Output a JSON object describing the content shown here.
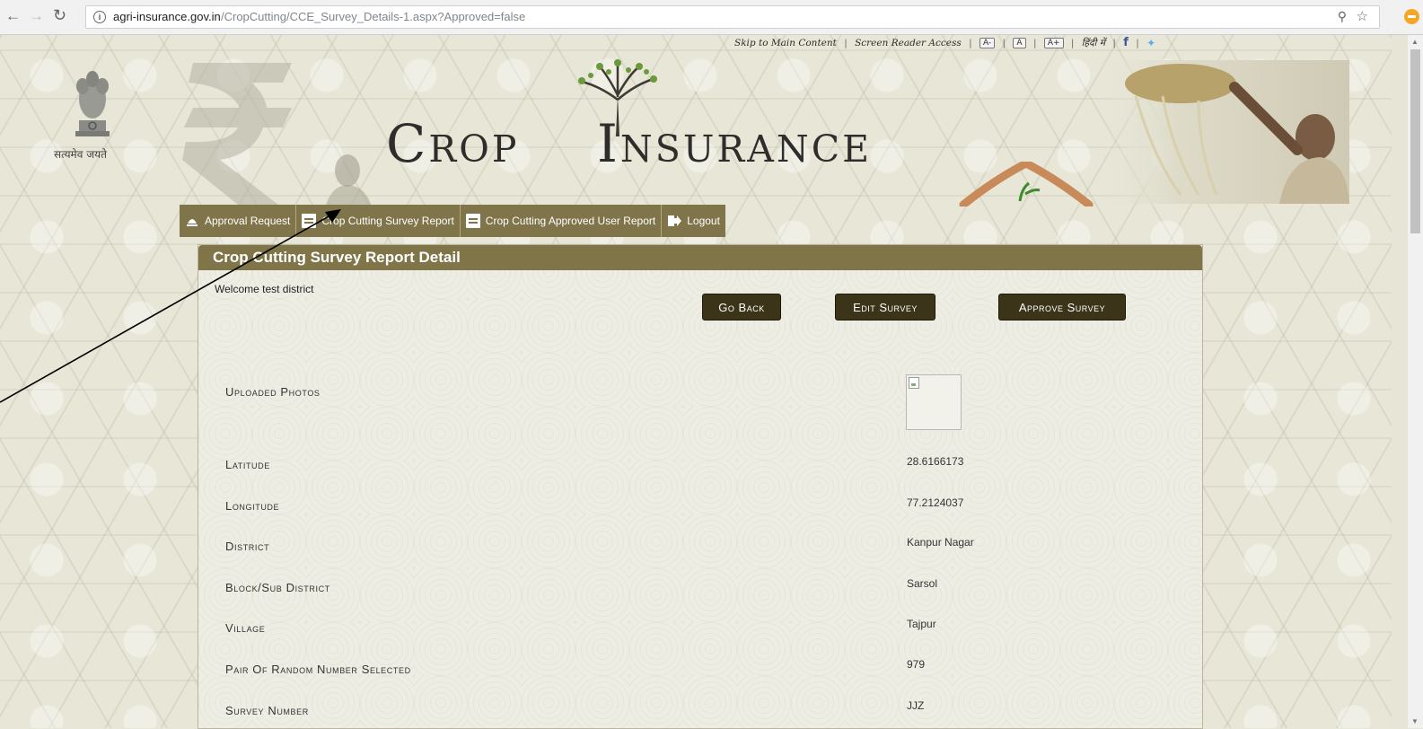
{
  "browser": {
    "url_host": "agri-insurance.gov.in",
    "url_path": "/CropCutting/CCE_Survey_Details-1.aspx?Approved=false"
  },
  "utility_bar": {
    "skip_link": "Skip to Main Content",
    "screen_reader": "Screen Reader Access",
    "font_decrease": "A-",
    "font_normal": "A",
    "font_increase": "A+",
    "hindi": "हिंदी में",
    "facebook": "f"
  },
  "header": {
    "emblem_caption": "सत्यमेव जयते",
    "title_first": "Crop",
    "title_second": "Insurance"
  },
  "menu": [
    {
      "label": "Approval Request"
    },
    {
      "label": "Crop Cutting Survey Report"
    },
    {
      "label": "Crop Cutting Approved User Report"
    },
    {
      "label": "Logout"
    }
  ],
  "panel": {
    "title": "Crop Cutting Survey Report Detail",
    "welcome": "Welcome test district",
    "buttons": {
      "go_back": "Go Back",
      "edit": "Edit Survey",
      "approve": "Approve Survey"
    },
    "fields": [
      {
        "label": "Uploaded Photos",
        "value": ""
      },
      {
        "label": "Latitude",
        "value": "28.6166173"
      },
      {
        "label": "Longitude",
        "value": "77.2124037"
      },
      {
        "label": "District",
        "value": "Kanpur Nagar"
      },
      {
        "label": "Block/Sub District",
        "value": "Sarsol"
      },
      {
        "label": "Village",
        "value": "Tajpur"
      },
      {
        "label": "Pair Of Random Number Selected",
        "value": "979"
      },
      {
        "label": "Survey Number",
        "value": "JJZ"
      }
    ]
  },
  "colors": {
    "menu_bg": "#80744a",
    "panel_header": "#7f7548",
    "button_bg": "#3b3418"
  }
}
